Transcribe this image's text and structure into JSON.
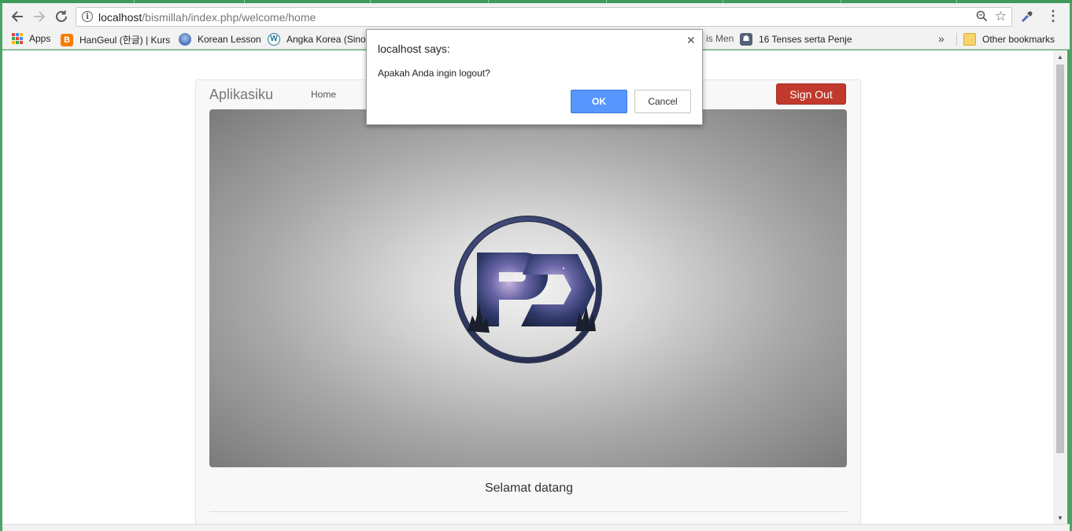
{
  "browser": {
    "url_host": "localhost",
    "url_path": "/bismillah/index.php/welcome/home",
    "bookmarks": [
      {
        "label": "Apps",
        "icon": "apps-grid-icon"
      },
      {
        "label": "HanGeul (한글) | Kurs",
        "icon": "blogger-icon",
        "color": "#f57d00"
      },
      {
        "label": "Korean Lesson",
        "icon": "globe-icon",
        "color": "#4a6fb5"
      },
      {
        "label": "Angka Korea (Sino",
        "icon": "wordpress-icon",
        "color": "#21759b"
      },
      {
        "label": "is Men",
        "icon": ""
      },
      {
        "label": "16 Tenses serta Penje",
        "icon": "ghost-icon",
        "color": "#56607a"
      }
    ],
    "more_bookmarks": "»",
    "other_bookmarks": "Other bookmarks"
  },
  "page": {
    "brand": "Aplikasiku",
    "nav_home": "Home",
    "signout_label": "Sign Out",
    "signout_color": "#c0392b",
    "welcome_text": "Selamat datang"
  },
  "dialog": {
    "title": "localhost says:",
    "message": "Apakah Anda ingin logout?",
    "ok_label": "OK",
    "cancel_label": "Cancel",
    "ok_color": "#5796ff"
  }
}
